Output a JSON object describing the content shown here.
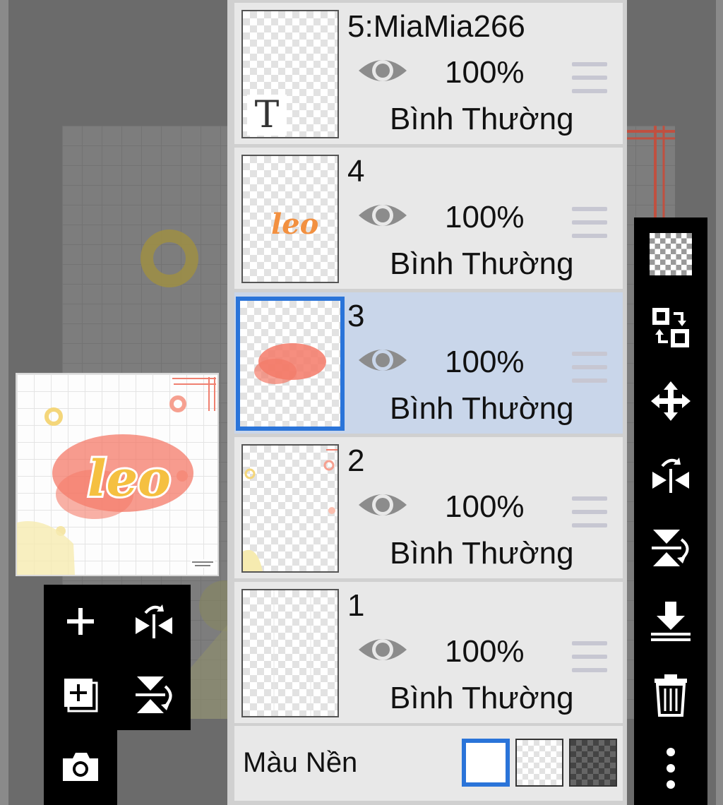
{
  "layers": [
    {
      "name": "5:MiaMia266",
      "opacity": "100%",
      "blend": "Bình Thường",
      "type_icon": "T"
    },
    {
      "name": "4",
      "opacity": "100%",
      "blend": "Bình Thường"
    },
    {
      "name": "3",
      "opacity": "100%",
      "blend": "Bình Thường",
      "selected": true
    },
    {
      "name": "2",
      "opacity": "100%",
      "blend": "Bình Thường"
    },
    {
      "name": "1",
      "opacity": "100%",
      "blend": "Bình Thường"
    }
  ],
  "thumbs": {
    "leo_text": "leo",
    "preview_text": "leo"
  },
  "background": {
    "label": "Màu Nền",
    "options": [
      "white",
      "transparent",
      "dark-checker"
    ],
    "selected": "white"
  },
  "colors": {
    "accent": "#2a74d9",
    "selected_row": "#c9d6ea",
    "coral": "#f26a5a",
    "yellow": "#f4c93c"
  },
  "left_toolbar": [
    "add-layer-icon",
    "flip-horizontal-icon",
    "add-copy-layer-icon",
    "flip-vertical-icon",
    "camera-icon"
  ],
  "right_toolbar": [
    "transparency-icon",
    "swap-layer-icon",
    "move-icon",
    "flip-horizontal-icon",
    "flip-vertical-icon",
    "merge-down-icon",
    "trash-icon",
    "more-icon"
  ]
}
